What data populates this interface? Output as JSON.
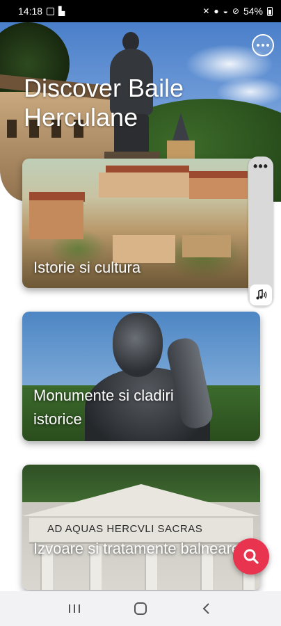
{
  "status_bar": {
    "time": "14:18",
    "battery": "54%"
  },
  "hero": {
    "title": "Discover Baile Herculane"
  },
  "cards": [
    {
      "title": "Istorie si cultura"
    },
    {
      "title": "Monumente si cladiri istorice",
      "inscription": ""
    },
    {
      "title": "Izvoare si tratamente balneare",
      "inscription": "AD AQUAS HERCVLI SACRAS"
    }
  ],
  "colors": {
    "accent": "#e8344f",
    "nav_background": "#f2f2f4"
  },
  "icons": {
    "hero_menu": "more-horizontal-icon",
    "side_menu": "more-horizontal-icon",
    "audio": "music-note-audio-icon",
    "fab": "search-icon",
    "nav_recents": "recents-icon",
    "nav_home": "home-icon",
    "nav_back": "back-chevron-icon"
  }
}
